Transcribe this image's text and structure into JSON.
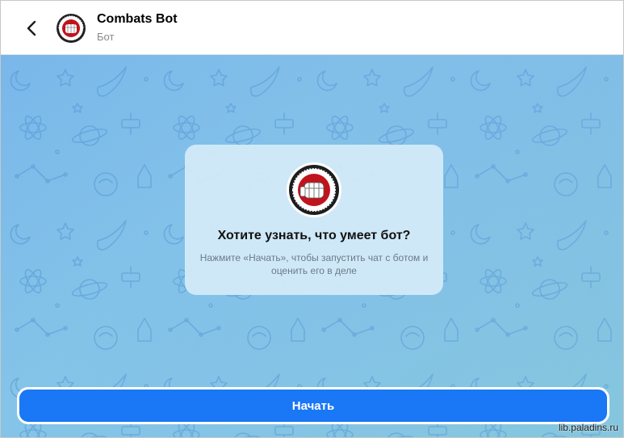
{
  "header": {
    "back_icon": "chevron-left-icon",
    "title": "Combats Bot",
    "subtitle": "Бот"
  },
  "info_card": {
    "title": "Хотите узнать, что умеет бот?",
    "description": "Нажмите «Начать», чтобы запустить чат с ботом и оценить его в деле"
  },
  "start_button": {
    "label": "Начать"
  },
  "watermark": {
    "text": "lib.paladins.ru"
  },
  "colors": {
    "accent": "#1a77f5",
    "background_top": "#79b7ea",
    "background_bottom": "#8dd3d8",
    "logo_red": "#c0141c"
  }
}
